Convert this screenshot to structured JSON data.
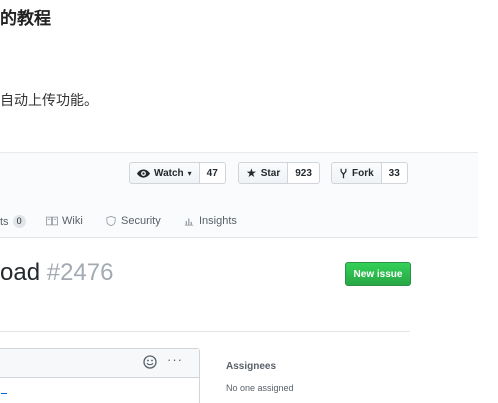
{
  "article": {
    "heading": "的教程",
    "text": "自动上传功能。"
  },
  "repo_actions": {
    "watch": {
      "label": "Watch",
      "count": "47",
      "icon": "eye-icon"
    },
    "star": {
      "label": "Star",
      "count": "923",
      "icon": "star-icon"
    },
    "fork": {
      "label": "Fork",
      "count": "33",
      "icon": "repo-forked-icon"
    }
  },
  "tabs": [
    {
      "label": "ts",
      "counter": "0"
    },
    {
      "label": "Wiki",
      "icon": "book-icon"
    },
    {
      "label": "Security",
      "icon": "shield-icon"
    },
    {
      "label": "Insights",
      "icon": "graph-icon"
    }
  ],
  "issue": {
    "title": "oad",
    "number": "#2476",
    "new_issue_label": "New issue"
  },
  "sidebar": {
    "assignees_label": "Assignees",
    "assignees_value": "No one assigned"
  },
  "colors": {
    "primary_green": "#2ea44f",
    "link_blue": "#0366d6",
    "muted_text": "#586069"
  }
}
